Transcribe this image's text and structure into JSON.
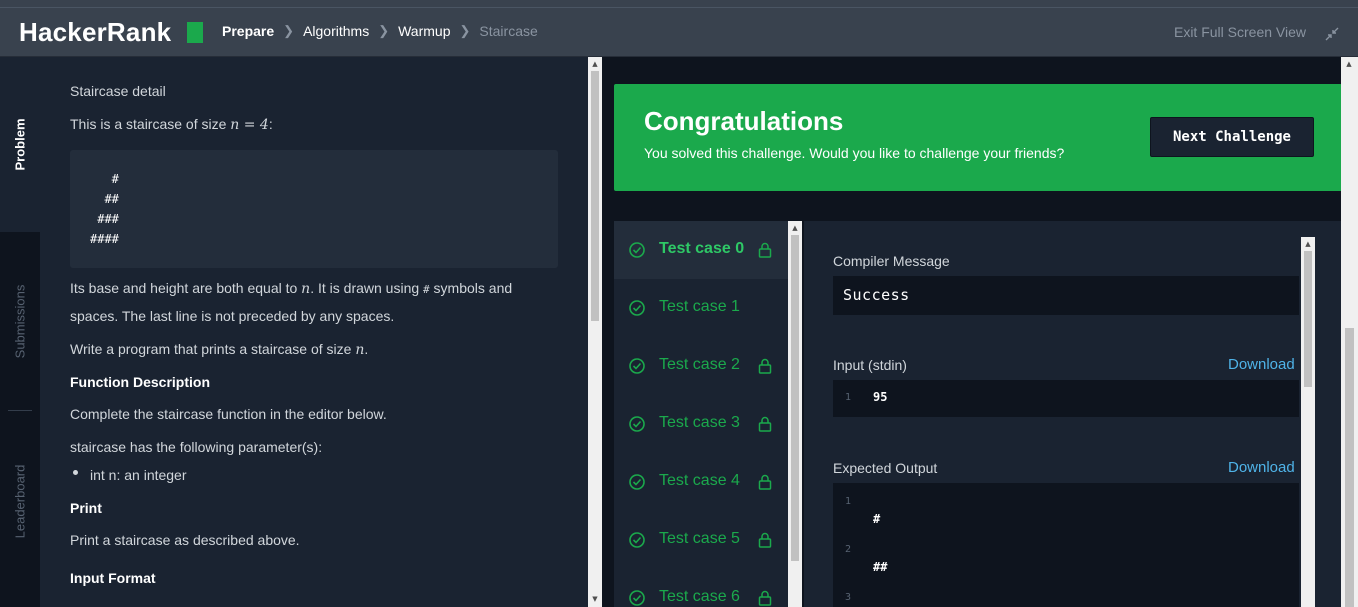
{
  "header": {
    "logo_text": "HackerRank",
    "breadcrumbs": [
      "Prepare",
      "Algorithms",
      "Warmup",
      "Staircase"
    ],
    "exit_label": "Exit Full Screen View"
  },
  "side_tabs": [
    "Problem",
    "Submissions",
    "Leaderboard"
  ],
  "problem": {
    "detail_title": "Staircase detail",
    "intro_prefix": "This is a staircase of size ",
    "intro_math": "n = 4",
    "intro_suffix": ":",
    "staircase_lines": [
      "   #",
      "  ##",
      " ###",
      "####"
    ],
    "base_text_1": "Its base and height are both equal to ",
    "base_math": "n",
    "base_text_2": ". It is drawn using ",
    "hash_symbol": "#",
    "base_text_3": " symbols and",
    "base_text_4": "spaces. The last line is not preceded by any spaces.",
    "write_prefix": "Write a program that prints a staircase of size ",
    "write_math": "n",
    "write_suffix": ".",
    "function_heading": "Function Description",
    "function_text": "Complete the staircase function in the editor below.",
    "params_text": "staircase has the following parameter(s):",
    "param_item": "int n: an integer",
    "print_heading": "Print",
    "print_text": "Print a staircase as described above.",
    "input_heading": "Input Format"
  },
  "banner": {
    "title": "Congratulations",
    "subtitle": "You solved this challenge. Would you like to challenge your friends?",
    "next_button": "Next Challenge",
    "color": "#1ba94c"
  },
  "test_cases": [
    {
      "label": "Test case 0",
      "locked": true,
      "passed": true
    },
    {
      "label": "Test case 1",
      "locked": false,
      "passed": true
    },
    {
      "label": "Test case 2",
      "locked": true,
      "passed": true
    },
    {
      "label": "Test case 3",
      "locked": true,
      "passed": true
    },
    {
      "label": "Test case 4",
      "locked": true,
      "passed": true
    },
    {
      "label": "Test case 5",
      "locked": true,
      "passed": true
    },
    {
      "label": "Test case 6",
      "locked": true,
      "passed": true
    }
  ],
  "output": {
    "compiler_label": "Compiler Message",
    "compiler_value": "Success",
    "input_label": "Input (stdin)",
    "download": "Download",
    "input_lines": [
      {
        "no": "1",
        "text": "95"
      }
    ],
    "expected_label": "Expected Output",
    "expected_lines": [
      {
        "no": "1",
        "text": "#"
      },
      {
        "no": "2",
        "text": "##"
      },
      {
        "no": "3",
        "text": ""
      }
    ]
  }
}
